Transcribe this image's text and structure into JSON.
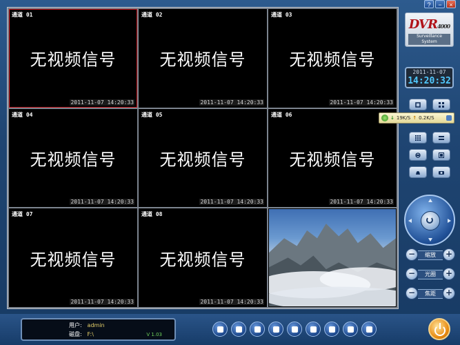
{
  "window_controls": {
    "help": "?",
    "minimize": "−",
    "close": "×"
  },
  "channels": [
    {
      "label": "通道 01",
      "status": "无视频信号",
      "timestamp": "2011-11-07 14:20:33",
      "selected": true
    },
    {
      "label": "通道 02",
      "status": "无视频信号",
      "timestamp": "2011-11-07 14:20:33"
    },
    {
      "label": "通道 03",
      "status": "无视频信号",
      "timestamp": "2011-11-07 14:20:33"
    },
    {
      "label": "通道 04",
      "status": "无视频信号",
      "timestamp": "2011-11-07 14:20:33"
    },
    {
      "label": "通道 05",
      "status": "无视频信号",
      "timestamp": "2011-11-07 14:20:33"
    },
    {
      "label": "通道 06",
      "status": "无视频信号",
      "timestamp": "2011-11-07 14:20:33"
    },
    {
      "label": "通道 07",
      "status": "无视频信号",
      "timestamp": "2011-11-07 14:20:33"
    },
    {
      "label": "通道 08",
      "status": "无视频信号",
      "timestamp": "2011-11-07 14:20:33"
    }
  ],
  "logo": {
    "brand": "DVR",
    "model": "4000",
    "tagline": "Surveillance System"
  },
  "clock": {
    "date": "2011-11-07",
    "time": "14:20:32"
  },
  "network": {
    "download": "19K/S",
    "upload": "0.2K/S"
  },
  "ptz_controls": {
    "zoom": "缩放",
    "iris": "光圈",
    "focus": "焦距",
    "minus": "−",
    "plus": "+"
  },
  "status_panel": {
    "user_label": "用户:",
    "user": "admin",
    "disk_label": "磁盘:",
    "disk": "F:\\",
    "version": "V 1.03"
  },
  "colors": {
    "accent": "#50c8ff",
    "selected_border": "#c4161c",
    "brand_red": "#b0131a"
  }
}
